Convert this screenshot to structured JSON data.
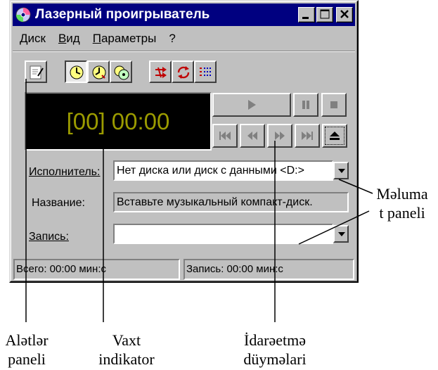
{
  "window": {
    "title": "Лазерный проигрыватель",
    "icon": "cd-player-icon"
  },
  "menu": [
    "Диск",
    "Вид",
    "Параметры",
    "?"
  ],
  "toolbar": {
    "buttons": [
      "edit-playlist-icon",
      "track-time-elapsed-icon",
      "track-time-remaining-icon",
      "disc-time-remaining-icon",
      "random-order-icon",
      "continuous-play-icon",
      "intro-play-icon"
    ]
  },
  "display": {
    "time": "[00] 00:00"
  },
  "controls": [
    "play-icon",
    "pause-icon",
    "stop-icon",
    "previous-track-icon",
    "skip-backward-icon",
    "skip-forward-icon",
    "next-track-icon",
    "eject-icon"
  ],
  "fields": {
    "artist_label": "Исполнитель:",
    "artist_value": "Нет диска или диск с данными <D:>",
    "title_label": "Название:",
    "title_value": "Вставьте музыкальный компакт-диск.",
    "track_label": "Запись:",
    "track_value": ""
  },
  "status": {
    "total": "Всего: 00:00 мин:с",
    "track": "Запись: 00:00 мин:с"
  },
  "annotations": {
    "info_panel_line1": "Məluma",
    "info_panel_line2": "t paneli",
    "toolbar_line1": "Alətlər",
    "toolbar_line2": "paneli",
    "time_line1": "Vaxt",
    "time_line2": "indikator",
    "controls_line1": "İdarəetmə",
    "controls_line2": "düyməlari"
  }
}
